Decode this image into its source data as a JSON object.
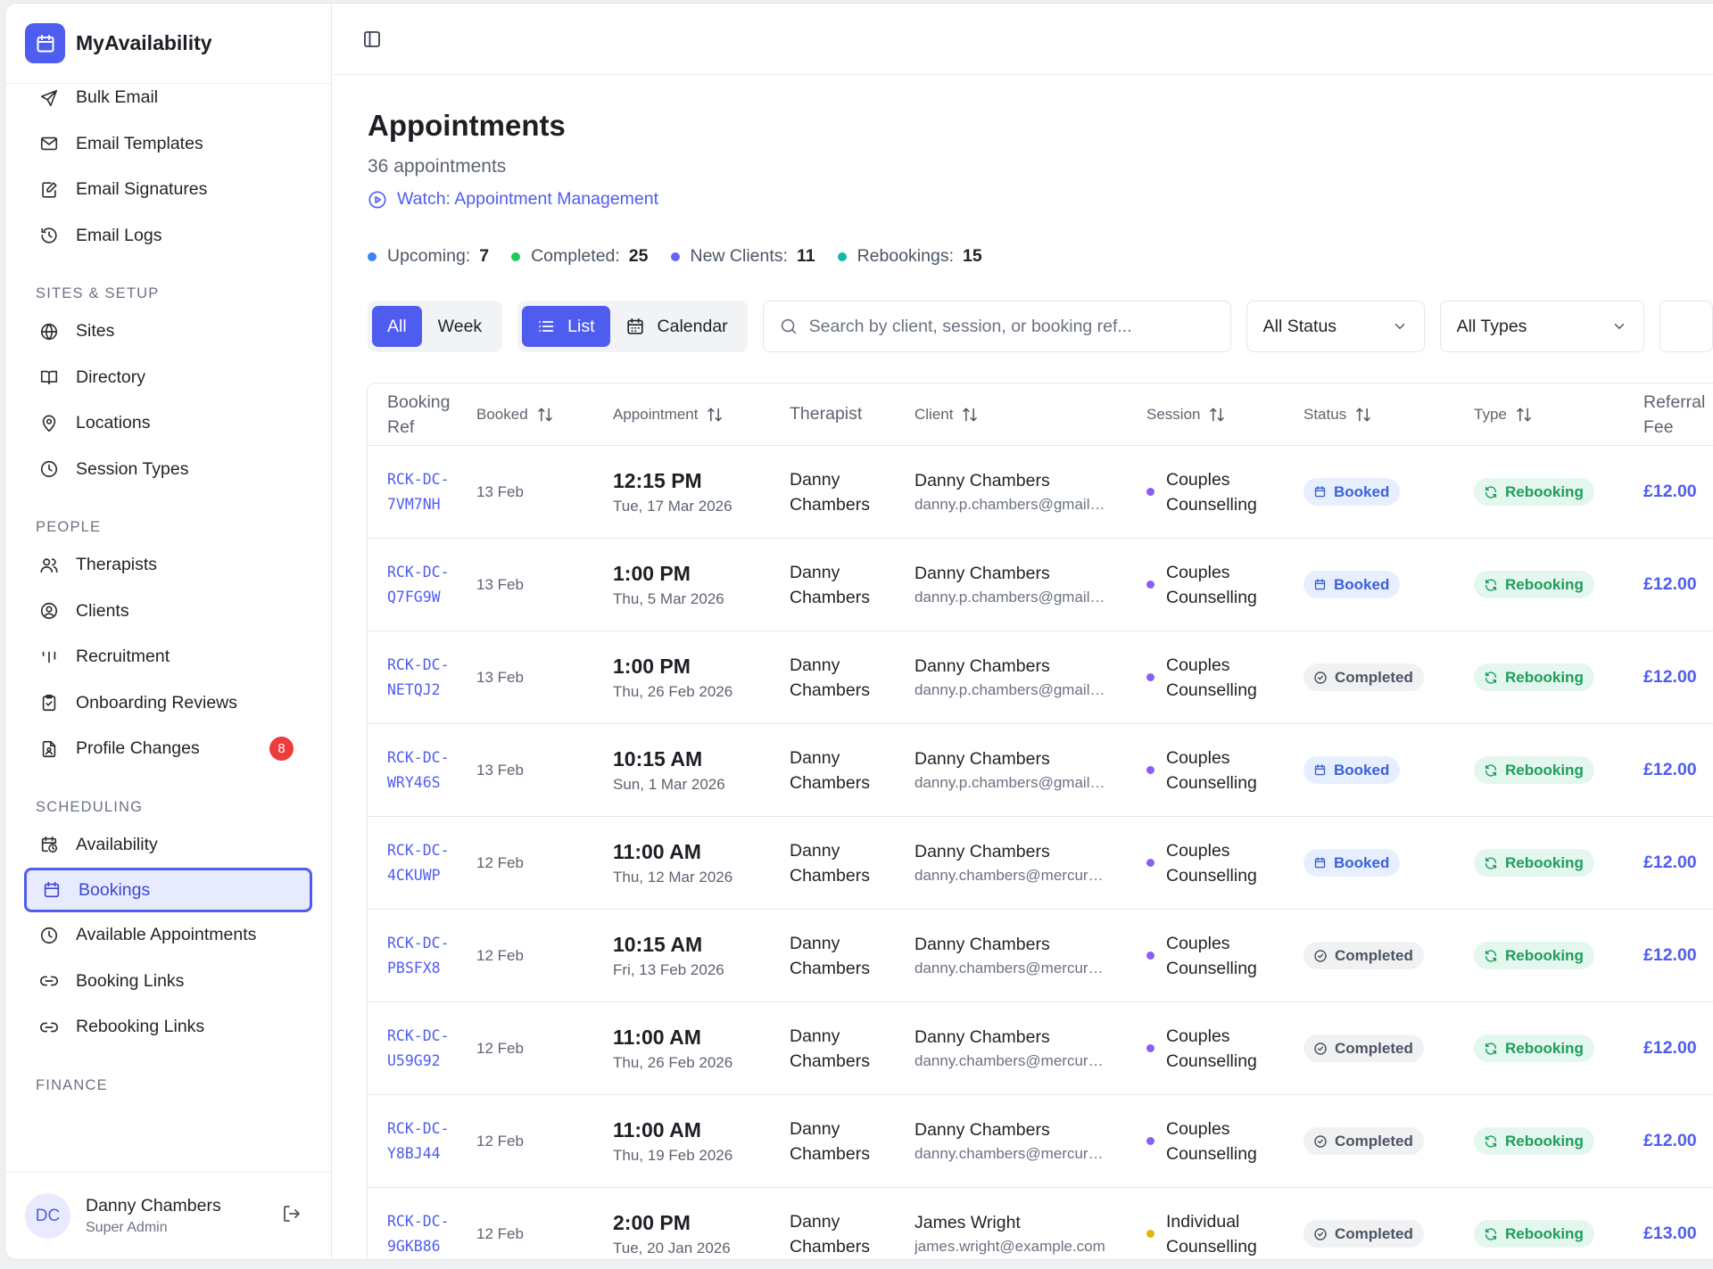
{
  "app": {
    "name": "MyAvailability"
  },
  "sidebar": {
    "top_items": [
      {
        "label": "Bulk Email",
        "icon": "send-icon"
      },
      {
        "label": "Email Templates",
        "icon": "mail-icon"
      },
      {
        "label": "Email Signatures",
        "icon": "signature-icon"
      },
      {
        "label": "Email Logs",
        "icon": "history-icon"
      }
    ],
    "groups": [
      {
        "title": "SITES & SETUP",
        "items": [
          {
            "label": "Sites",
            "icon": "globe-icon"
          },
          {
            "label": "Directory",
            "icon": "book-icon"
          },
          {
            "label": "Locations",
            "icon": "map-pin-icon"
          },
          {
            "label": "Session Types",
            "icon": "clock-icon"
          }
        ]
      },
      {
        "title": "PEOPLE",
        "items": [
          {
            "label": "Therapists",
            "icon": "users-icon"
          },
          {
            "label": "Clients",
            "icon": "user-circle-icon"
          },
          {
            "label": "Recruitment",
            "icon": "bars-icon"
          },
          {
            "label": "Onboarding Reviews",
            "icon": "clipboard-check-icon"
          },
          {
            "label": "Profile Changes",
            "icon": "file-user-icon",
            "badge": "8"
          }
        ]
      },
      {
        "title": "SCHEDULING",
        "items": [
          {
            "label": "Availability",
            "icon": "calendar-clock-icon"
          },
          {
            "label": "Bookings",
            "icon": "calendar-icon",
            "active": true
          },
          {
            "label": "Available Appointments",
            "icon": "clock-icon"
          },
          {
            "label": "Booking Links",
            "icon": "link-icon"
          },
          {
            "label": "Rebooking Links",
            "icon": "link-icon"
          }
        ]
      },
      {
        "title": "FINANCE",
        "items": []
      }
    ],
    "user": {
      "initials": "DC",
      "name": "Danny Chambers",
      "role": "Super Admin"
    }
  },
  "page": {
    "title": "Appointments",
    "subtitle": "36 appointments",
    "watch_label": "Watch: Appointment Management",
    "stats": [
      {
        "label": "Upcoming:",
        "value": "7",
        "color": "#3b82f6"
      },
      {
        "label": "Completed:",
        "value": "25",
        "color": "#22c55e"
      },
      {
        "label": "New Clients:",
        "value": "11",
        "color": "#6366f1"
      },
      {
        "label": "Rebookings:",
        "value": "15",
        "color": "#14b8a6"
      }
    ]
  },
  "toolbar": {
    "range": [
      "All",
      "Week"
    ],
    "view_list": "List",
    "view_calendar": "Calendar",
    "search_placeholder": "Search by client, session, or booking ref...",
    "status_select": "All Status",
    "type_select": "All Types"
  },
  "table": {
    "headers": {
      "ref": "Booking Ref",
      "booked": "Booked",
      "appointment": "Appointment",
      "therapist": "Therapist",
      "client": "Client",
      "session": "Session",
      "status": "Status",
      "type": "Type",
      "fee": "Referral Fee"
    },
    "rows": [
      {
        "ref1": "RCK-DC-",
        "ref2": "7VM7NH",
        "booked": "13 Feb",
        "time": "12:15 PM",
        "date": "Tue, 17 Mar 2026",
        "ther1": "Danny",
        "ther2": "Chambers",
        "client": "Danny Chambers",
        "email": "danny.p.chambers@gmail.com",
        "sess1": "Couples",
        "sess2": "Counselling",
        "sess_color": "#8b5cf6",
        "status": "Booked",
        "type": "Rebooking",
        "fee": "£12.00"
      },
      {
        "ref1": "RCK-DC-",
        "ref2": "Q7FG9W",
        "booked": "13 Feb",
        "time": "1:00 PM",
        "date": "Thu, 5 Mar 2026",
        "ther1": "Danny",
        "ther2": "Chambers",
        "client": "Danny Chambers",
        "email": "danny.p.chambers@gmail.com",
        "sess1": "Couples",
        "sess2": "Counselling",
        "sess_color": "#8b5cf6",
        "status": "Booked",
        "type": "Rebooking",
        "fee": "£12.00"
      },
      {
        "ref1": "RCK-DC-",
        "ref2": "NETQJ2",
        "booked": "13 Feb",
        "time": "1:00 PM",
        "date": "Thu, 26 Feb 2026",
        "ther1": "Danny",
        "ther2": "Chambers",
        "client": "Danny Chambers",
        "email": "danny.p.chambers@gmail.com",
        "sess1": "Couples",
        "sess2": "Counselling",
        "sess_color": "#8b5cf6",
        "status": "Completed",
        "type": "Rebooking",
        "fee": "£12.00"
      },
      {
        "ref1": "RCK-DC-",
        "ref2": "WRY46S",
        "booked": "13 Feb",
        "time": "10:15 AM",
        "date": "Sun, 1 Mar 2026",
        "ther1": "Danny",
        "ther2": "Chambers",
        "client": "Danny Chambers",
        "email": "danny.p.chambers@gmail.com",
        "sess1": "Couples",
        "sess2": "Counselling",
        "sess_color": "#8b5cf6",
        "status": "Booked",
        "type": "Rebooking",
        "fee": "£12.00"
      },
      {
        "ref1": "RCK-DC-",
        "ref2": "4CKUWP",
        "booked": "12 Feb",
        "time": "11:00 AM",
        "date": "Thu, 12 Mar 2026",
        "ther1": "Danny",
        "ther2": "Chambers",
        "client": "Danny Chambers",
        "email": "danny.chambers@mercury.com",
        "sess1": "Couples",
        "sess2": "Counselling",
        "sess_color": "#8b5cf6",
        "status": "Booked",
        "type": "Rebooking",
        "fee": "£12.00"
      },
      {
        "ref1": "RCK-DC-",
        "ref2": "PBSFX8",
        "booked": "12 Feb",
        "time": "10:15 AM",
        "date": "Fri, 13 Feb 2026",
        "ther1": "Danny",
        "ther2": "Chambers",
        "client": "Danny Chambers",
        "email": "danny.chambers@mercury.com",
        "sess1": "Couples",
        "sess2": "Counselling",
        "sess_color": "#8b5cf6",
        "status": "Completed",
        "type": "Rebooking",
        "fee": "£12.00"
      },
      {
        "ref1": "RCK-DC-",
        "ref2": "U59G92",
        "booked": "12 Feb",
        "time": "11:00 AM",
        "date": "Thu, 26 Feb 2026",
        "ther1": "Danny",
        "ther2": "Chambers",
        "client": "Danny Chambers",
        "email": "danny.chambers@mercury.com",
        "sess1": "Couples",
        "sess2": "Counselling",
        "sess_color": "#8b5cf6",
        "status": "Completed",
        "type": "Rebooking",
        "fee": "£12.00"
      },
      {
        "ref1": "RCK-DC-",
        "ref2": "Y8BJ44",
        "booked": "12 Feb",
        "time": "11:00 AM",
        "date": "Thu, 19 Feb 2026",
        "ther1": "Danny",
        "ther2": "Chambers",
        "client": "Danny Chambers",
        "email": "danny.chambers@mercury.com",
        "sess1": "Couples",
        "sess2": "Counselling",
        "sess_color": "#8b5cf6",
        "status": "Completed",
        "type": "Rebooking",
        "fee": "£12.00"
      },
      {
        "ref1": "RCK-DC-",
        "ref2": "9GKB86",
        "booked": "12 Feb",
        "time": "2:00 PM",
        "date": "Tue, 20 Jan 2026",
        "ther1": "Danny",
        "ther2": "Chambers",
        "client": "James Wright",
        "email": "james.wright@example.com",
        "sess1": "Individual",
        "sess2": "Counselling",
        "sess_color": "#eab308",
        "status": "Completed",
        "type": "Rebooking",
        "fee": "£13.00"
      }
    ]
  }
}
